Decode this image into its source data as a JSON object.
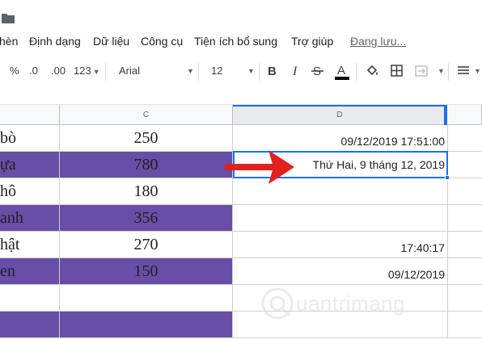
{
  "menu": {
    "items": [
      "hèn",
      "Định dạng",
      "Dữ liệu",
      "Công cụ",
      "Tiện ích bổ sung",
      "Trợ giúp"
    ],
    "status": "Đang lưu..."
  },
  "toolbar": {
    "percent": "%",
    "decrease_decimal": ".0",
    "increase_decimal": ".00",
    "more_formats": "123",
    "font": "Arial",
    "font_size": "12"
  },
  "grid": {
    "columns": [
      "C",
      "D"
    ],
    "rows": [
      {
        "b": "bò",
        "c": "250",
        "d": "09/12/2019 17:51:00",
        "purple": false
      },
      {
        "b": "ựa",
        "c": "780",
        "d": "Thứ Hai, 9 tháng 12, 2019",
        "purple": true
      },
      {
        "b": "hô",
        "c": "180",
        "d": "",
        "purple": false
      },
      {
        "b": "anh",
        "c": "356",
        "d": "",
        "purple": true
      },
      {
        "b": "hật",
        "c": "270",
        "d": "17:40:17",
        "purple": false
      },
      {
        "b": "en",
        "c": "150",
        "d": "09/12/2019",
        "purple": true
      },
      {
        "b": "",
        "c": "",
        "d": "",
        "purple": false
      },
      {
        "b": "",
        "c": "",
        "d": "",
        "purple": true
      }
    ]
  },
  "watermark": {
    "text": "uantrimang"
  },
  "colors": {
    "accent": "#1a73e8",
    "row_fill": "#674ea7",
    "arrow": "#e0211d"
  }
}
